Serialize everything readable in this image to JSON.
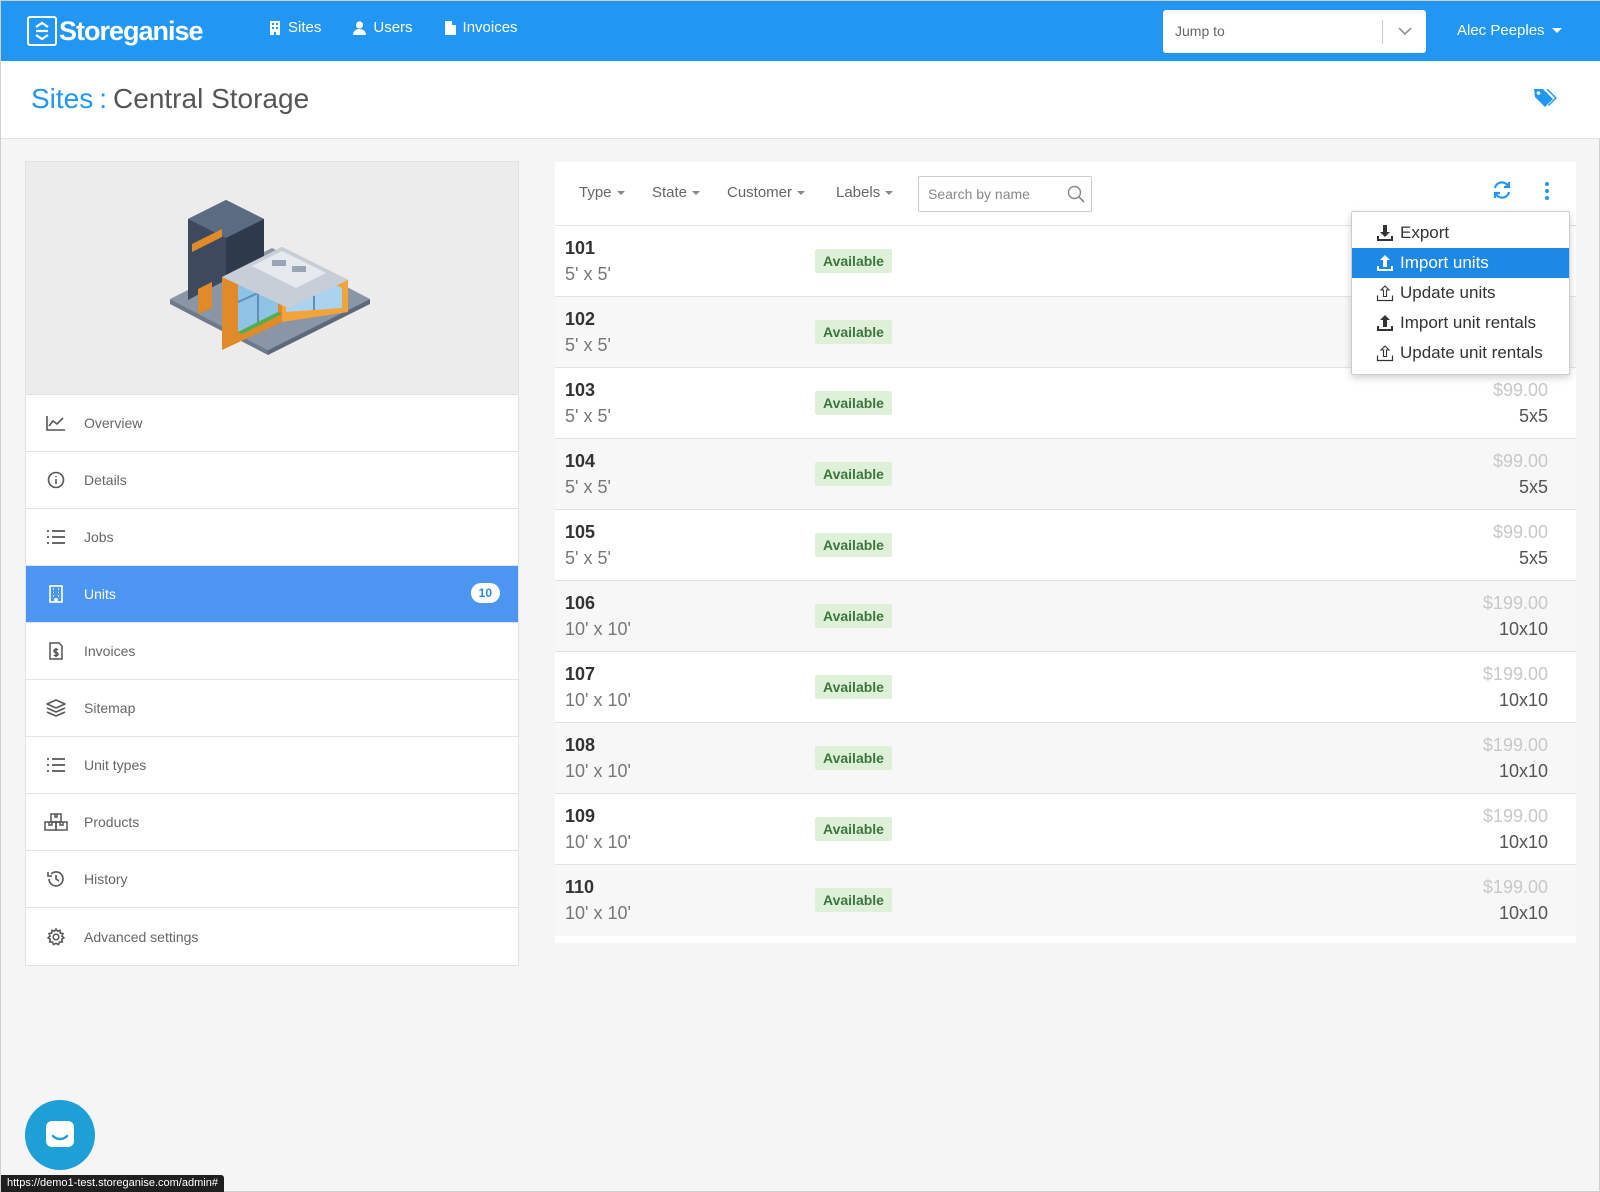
{
  "app": {
    "brand": "Storeganise"
  },
  "topnav": {
    "items": [
      {
        "label": "Sites",
        "icon": "building-icon"
      },
      {
        "label": "Users",
        "icon": "user-icon"
      },
      {
        "label": "Invoices",
        "icon": "document-icon"
      }
    ],
    "jump_to_placeholder": "Jump to",
    "user_name": "Alec Peeples"
  },
  "header": {
    "breadcrumb_root": "Sites",
    "separator": ":",
    "title": "Central Storage"
  },
  "sidebar": {
    "items": [
      {
        "label": "Overview",
        "icon": "chart-icon"
      },
      {
        "label": "Details",
        "icon": "info-icon"
      },
      {
        "label": "Jobs",
        "icon": "list-icon"
      },
      {
        "label": "Units",
        "icon": "building-icon",
        "badge": "10",
        "active": true
      },
      {
        "label": "Invoices",
        "icon": "invoice-icon"
      },
      {
        "label": "Sitemap",
        "icon": "layers-icon"
      },
      {
        "label": "Unit types",
        "icon": "list-icon"
      },
      {
        "label": "Products",
        "icon": "boxes-icon"
      },
      {
        "label": "History",
        "icon": "history-icon"
      },
      {
        "label": "Advanced settings",
        "icon": "gear-icon"
      }
    ]
  },
  "filters": {
    "type": "Type",
    "state": "State",
    "customer": "Customer",
    "labels": "Labels",
    "search_placeholder": "Search by name"
  },
  "units": [
    {
      "number": "101",
      "size": "5' x 5'",
      "status": "Available",
      "price": "",
      "type": ""
    },
    {
      "number": "102",
      "size": "5' x 5'",
      "status": "Available",
      "price": "",
      "type": ""
    },
    {
      "number": "103",
      "size": "5' x 5'",
      "status": "Available",
      "price": "$99.00",
      "type": "5x5"
    },
    {
      "number": "104",
      "size": "5' x 5'",
      "status": "Available",
      "price": "$99.00",
      "type": "5x5"
    },
    {
      "number": "105",
      "size": "5' x 5'",
      "status": "Available",
      "price": "$99.00",
      "type": "5x5"
    },
    {
      "number": "106",
      "size": "10' x 10'",
      "status": "Available",
      "price": "$199.00",
      "type": "10x10"
    },
    {
      "number": "107",
      "size": "10' x 10'",
      "status": "Available",
      "price": "$199.00",
      "type": "10x10"
    },
    {
      "number": "108",
      "size": "10' x 10'",
      "status": "Available",
      "price": "$199.00",
      "type": "10x10"
    },
    {
      "number": "109",
      "size": "10' x 10'",
      "status": "Available",
      "price": "$199.00",
      "type": "10x10"
    },
    {
      "number": "110",
      "size": "10' x 10'",
      "status": "Available",
      "price": "$199.00",
      "type": "10x10"
    }
  ],
  "actions_menu": {
    "items": [
      {
        "label": "Export",
        "icon": "download-icon"
      },
      {
        "label": "Import units",
        "icon": "upload-icon",
        "highlighted": true
      },
      {
        "label": "Update units",
        "icon": "upload-outline-icon"
      },
      {
        "label": "Import unit rentals",
        "icon": "upload-icon"
      },
      {
        "label": "Update unit rentals",
        "icon": "upload-outline-icon"
      }
    ]
  },
  "statusbar": {
    "url": "https://demo1-test.storeganise.com/admin#"
  },
  "colors": {
    "primary": "#2196f3",
    "active_item": "#4c96f2",
    "available_bg": "#dff0d8",
    "available_text": "#3c763d"
  }
}
